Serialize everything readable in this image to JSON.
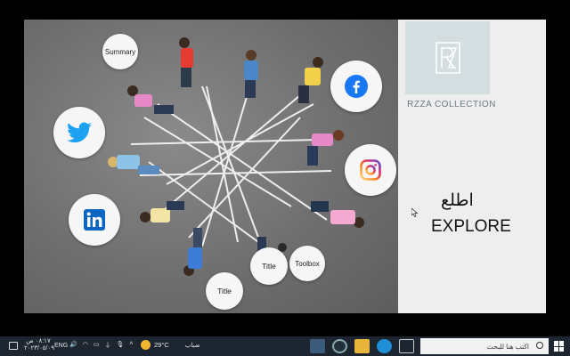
{
  "slide": {
    "circles": {
      "summary": "Summary",
      "title_1": "Title",
      "title_2": "Title",
      "toolbox": "Toolbox"
    },
    "brand_name": "RZZA COLLECTION",
    "arabic_text": "اطلع",
    "explore_text": "EXPLORE"
  },
  "taskbar": {
    "time": "٠٨:١٧ ص",
    "date": "٢٠٢٣/٠٥/٠٩",
    "language": "ENG",
    "weather_temp": "29°C",
    "weather_label": "ضباب",
    "search_placeholder": "اكتب هنا للبحث"
  },
  "colors": {
    "facebook": "#1877f2",
    "twitter": "#1da1f2",
    "linkedin": "#0a66c2",
    "taskbar_bg": "#1c2530"
  }
}
